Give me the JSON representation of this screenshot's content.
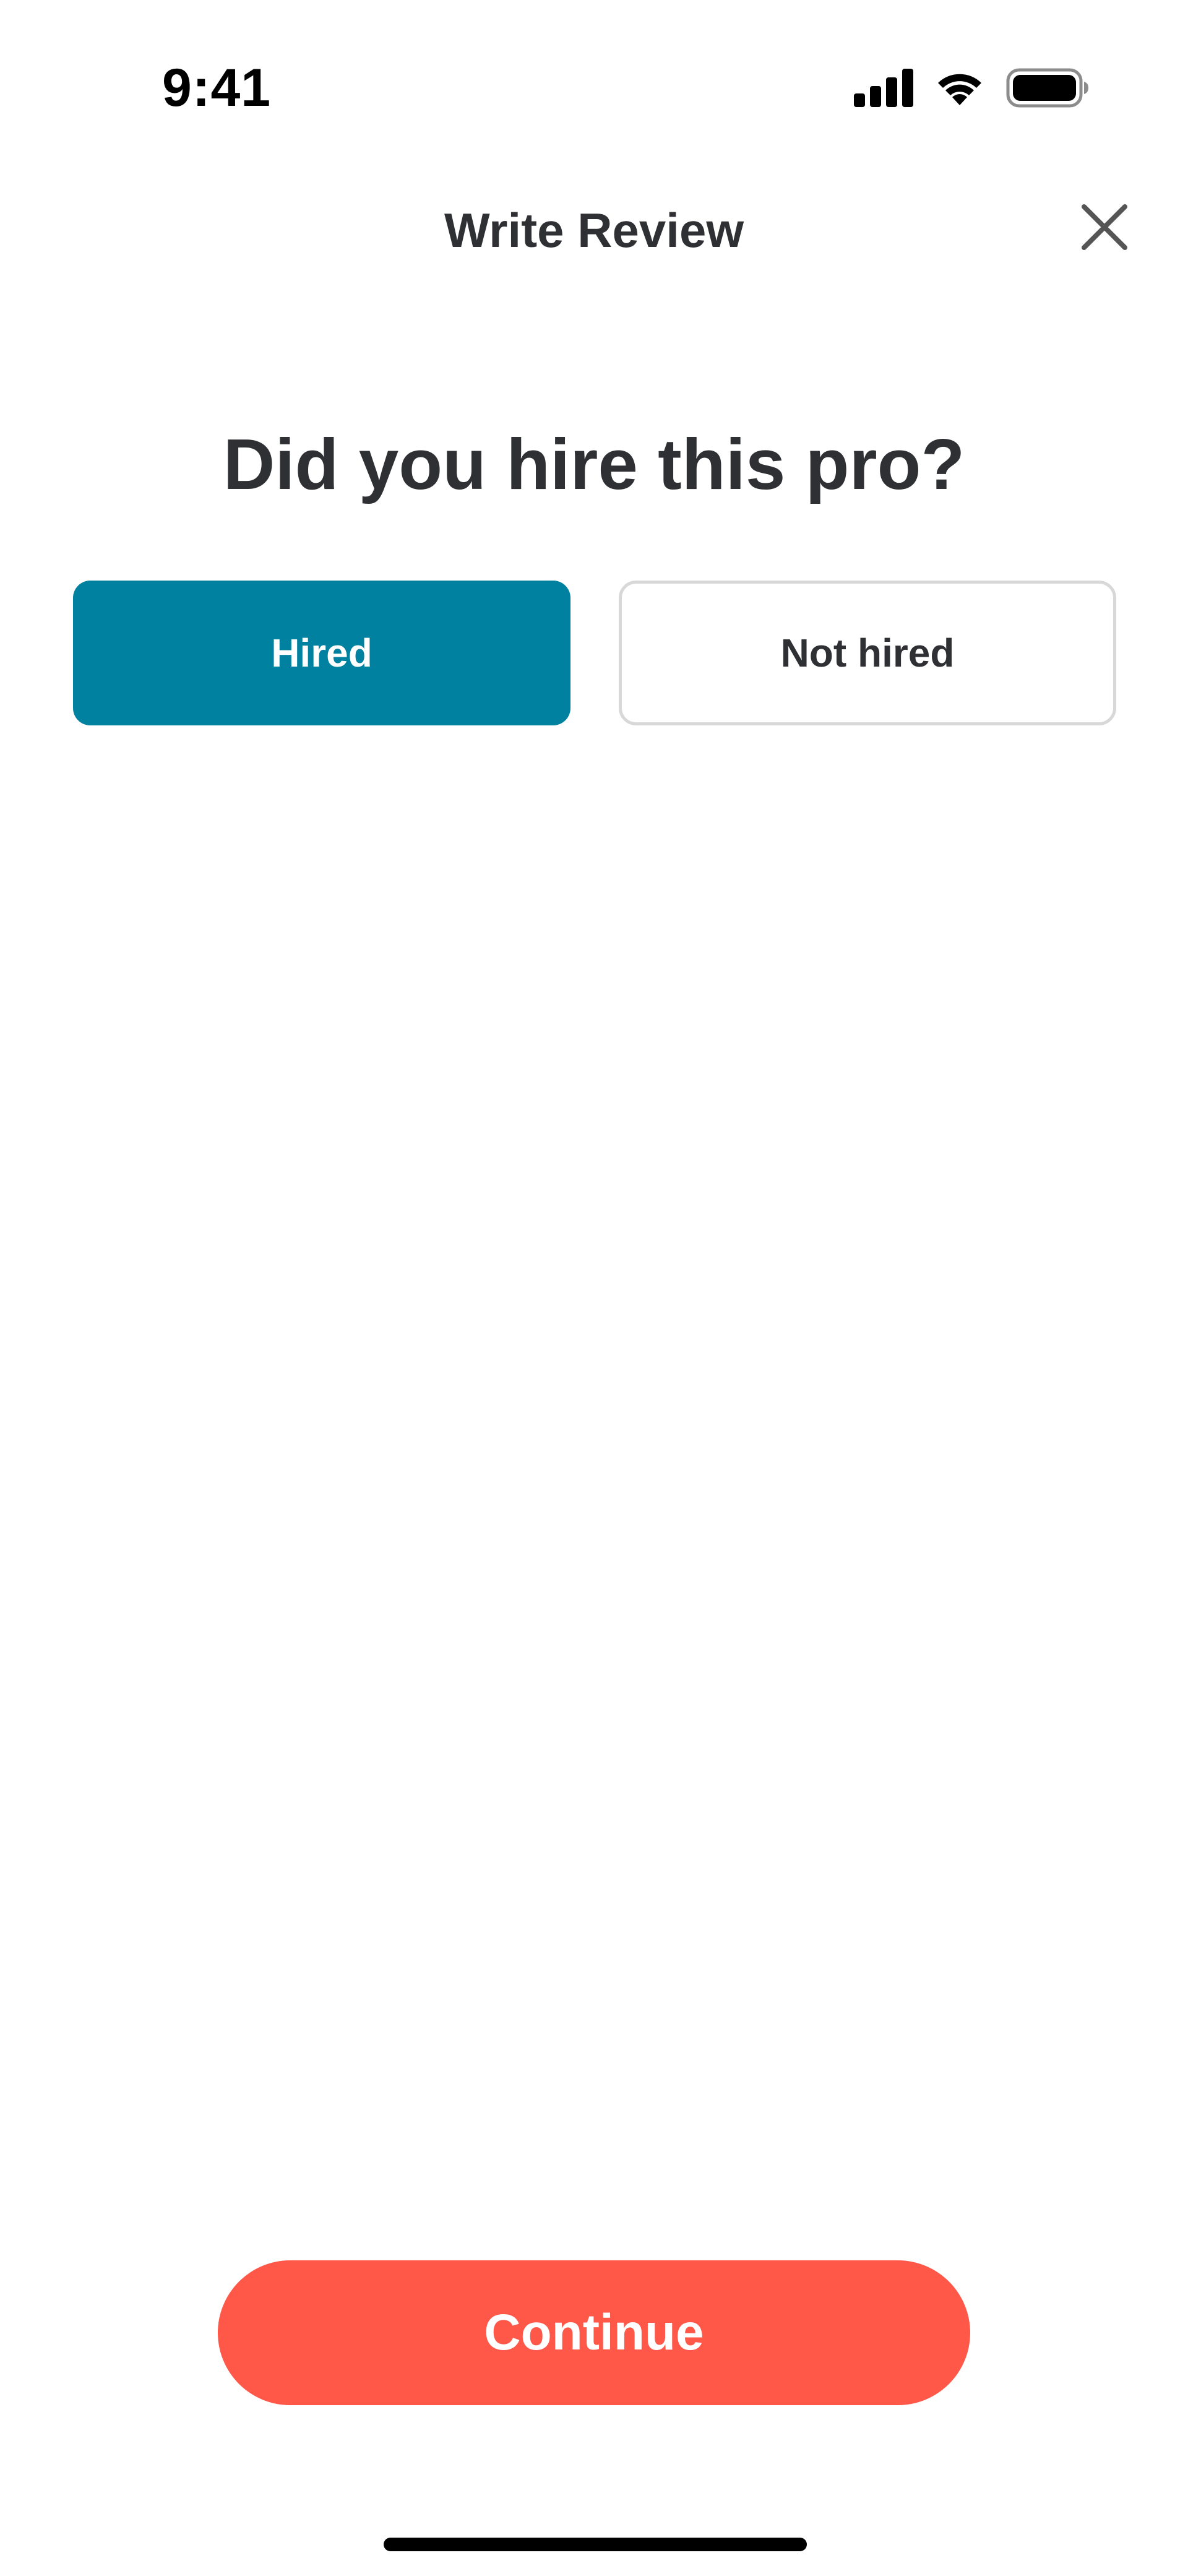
{
  "status_bar": {
    "time": "9:41",
    "icons": [
      "cellular-signal-icon",
      "wifi-icon",
      "battery-icon"
    ]
  },
  "header": {
    "title": "Write Review",
    "close_icon": "close-icon"
  },
  "question": {
    "text": "Did you hire this pro?"
  },
  "options": {
    "hired_label": "Hired",
    "not_hired_label": "Not hired",
    "selected": "Hired"
  },
  "footer": {
    "continue_label": "Continue"
  },
  "colors": {
    "selected_option": "#00819f",
    "continue_button": "#ff5748",
    "text": "#2f3033"
  }
}
